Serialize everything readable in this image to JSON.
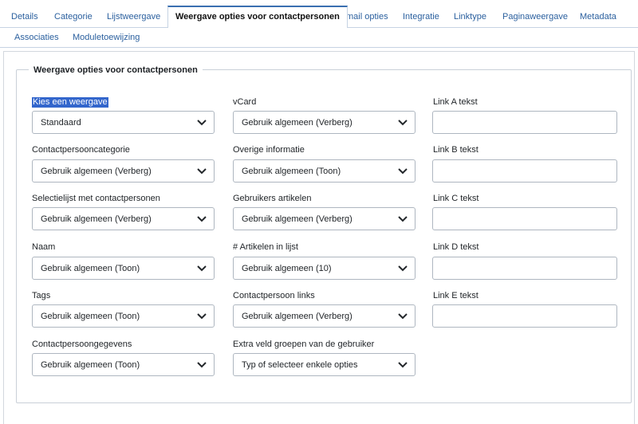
{
  "tabs": [
    {
      "label": "Details"
    },
    {
      "label": "Categorie"
    },
    {
      "label": "Lijstweergave"
    },
    {
      "label": "Weergave opties voor contactpersonen",
      "active": true
    },
    {
      "label": "E-mail opties"
    },
    {
      "label": "Integratie"
    },
    {
      "label": "Linktype"
    },
    {
      "label": "Paginaweergave"
    },
    {
      "label": "Metadata"
    },
    {
      "label": "Associaties"
    },
    {
      "label": "Moduletoewijzing"
    }
  ],
  "fieldset": {
    "legend": "Weergave opties voor contactpersonen"
  },
  "col1": [
    {
      "label": "Kies een weergave",
      "value": "Standaard"
    },
    {
      "label": "Contactpersooncategorie",
      "value": "Gebruik algemeen (Verberg)"
    },
    {
      "label": "Selectielijst met contactpersonen",
      "value": "Gebruik algemeen (Verberg)"
    },
    {
      "label": "Naam",
      "value": "Gebruik algemeen (Toon)"
    },
    {
      "label": "Tags",
      "value": "Gebruik algemeen (Toon)"
    },
    {
      "label": "Contactpersoongegevens",
      "value": "Gebruik algemeen (Toon)"
    }
  ],
  "col2": [
    {
      "label": "vCard",
      "value": "Gebruik algemeen (Verberg)"
    },
    {
      "label": "Overige informatie",
      "value": "Gebruik algemeen (Toon)"
    },
    {
      "label": "Gebruikers artikelen",
      "value": "Gebruik algemeen (Verberg)"
    },
    {
      "label": "# Artikelen in lijst",
      "value": "Gebruik algemeen (10)"
    },
    {
      "label": "Contactpersoon links",
      "value": "Gebruik algemeen (Verberg)"
    },
    {
      "label": "Extra veld groepen van de gebruiker",
      "value": "Typ of selecteer enkele opties"
    }
  ],
  "col3": [
    {
      "label": "Link A tekst",
      "value": ""
    },
    {
      "label": "Link B tekst",
      "value": ""
    },
    {
      "label": "Link C tekst",
      "value": ""
    },
    {
      "label": "Link D tekst",
      "value": ""
    },
    {
      "label": "Link E tekst",
      "value": ""
    }
  ],
  "icons": {
    "dropdown": "chevron-down-icon"
  },
  "colors": {
    "accent": "#3a6fb0",
    "link": "#2a5f9e",
    "selection": "#3366cc",
    "border": "#aeb6c0"
  }
}
